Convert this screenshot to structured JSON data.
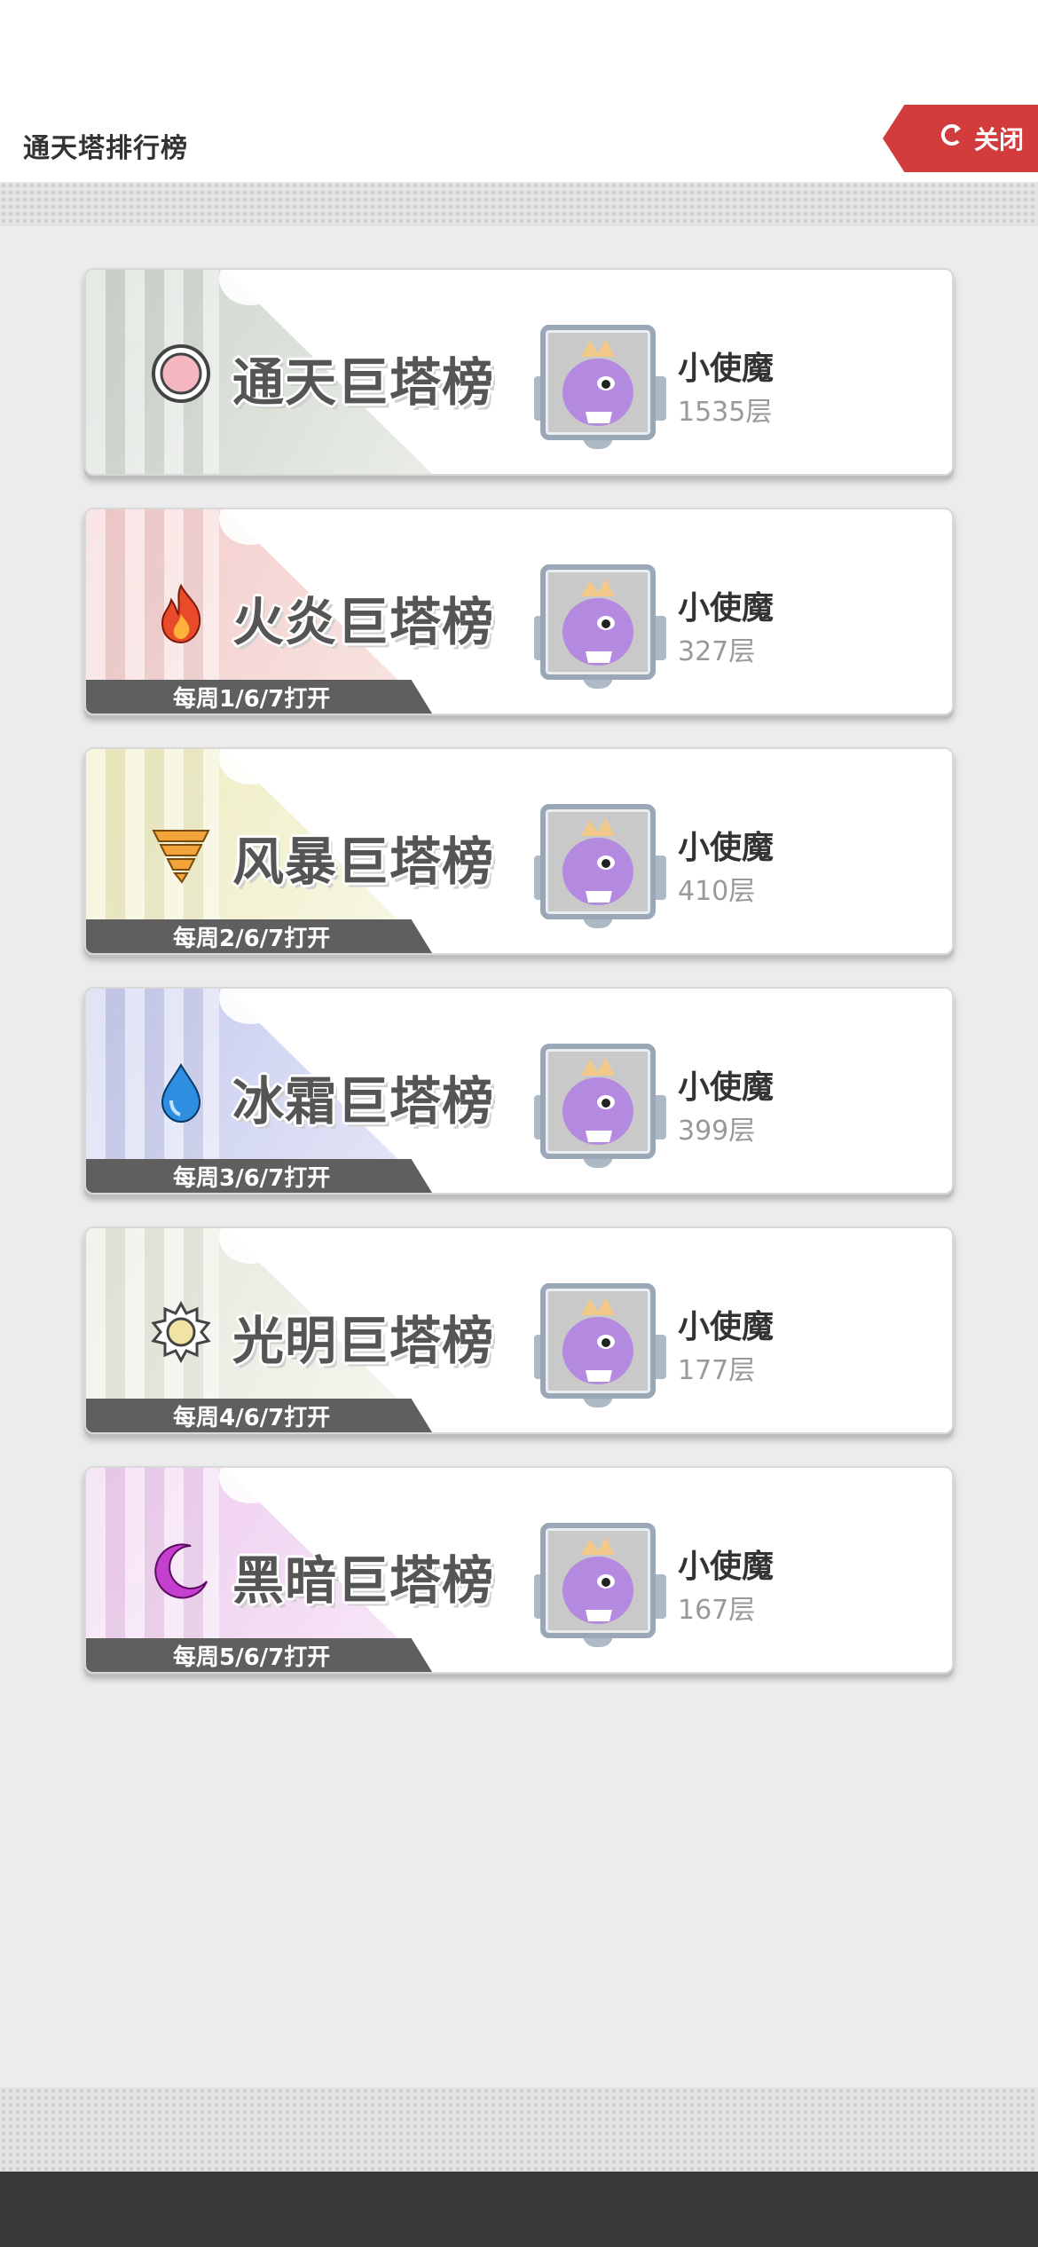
{
  "header": {
    "title": "通天塔排行榜",
    "close_label": "关闭",
    "close_icon": "undo-arrow-icon"
  },
  "boards": [
    {
      "id": "tongtian",
      "title": "通天巨塔榜",
      "icon": "ring-icon",
      "accent": "#f4b7c0",
      "schedule": "",
      "player": "小使魔",
      "floor": "1535层",
      "banner_color": "#8aa08a"
    },
    {
      "id": "fire",
      "title": "火炎巨塔榜",
      "icon": "flame-icon",
      "accent": "#e84a2a",
      "schedule": "每周1/6/7打开",
      "player": "小使魔",
      "floor": "327层",
      "banner_color": "#e48a8a"
    },
    {
      "id": "storm",
      "title": "风暴巨塔榜",
      "icon": "tornado-icon",
      "accent": "#e8a23c",
      "schedule": "每周2/6/7打开",
      "player": "小使魔",
      "floor": "410层",
      "banner_color": "#d8d46a"
    },
    {
      "id": "ice",
      "title": "冰霜巨塔榜",
      "icon": "water-drop-icon",
      "accent": "#2e8fe0",
      "schedule": "每周3/6/7打开",
      "player": "小使魔",
      "floor": "399层",
      "banner_color": "#7a86d8"
    },
    {
      "id": "light",
      "title": "光明巨塔榜",
      "icon": "sun-icon",
      "accent": "#f1e3a4",
      "schedule": "每周4/6/7打开",
      "player": "小使魔",
      "floor": "177层",
      "banner_color": "#c8c8b0"
    },
    {
      "id": "dark",
      "title": "黑暗巨塔榜",
      "icon": "crescent-moon-icon",
      "accent": "#c43fcf",
      "schedule": "每周5/6/7打开",
      "player": "小使魔",
      "floor": "167层",
      "banner_color": "#d88ad8"
    }
  ]
}
